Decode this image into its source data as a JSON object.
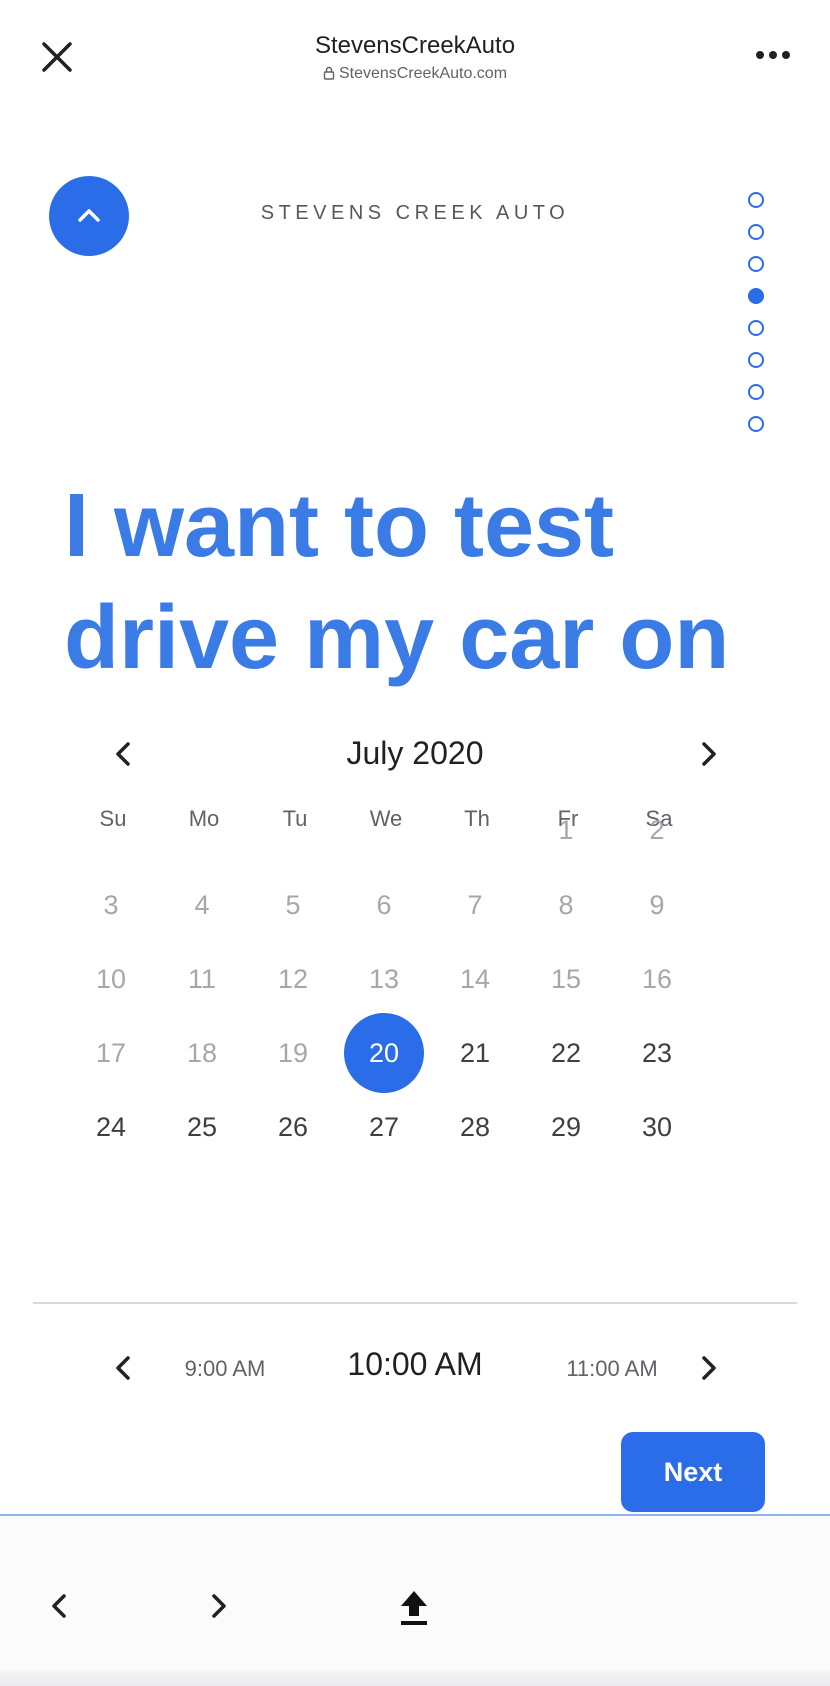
{
  "browser": {
    "title": "StevensCreekAuto",
    "url": "StevensCreekAuto.com"
  },
  "page": {
    "brand": "STEVENS CREEK AUTO",
    "headline_line1": "I want to test",
    "headline_line2": "drive my car on",
    "progress": {
      "total_steps": 8,
      "current_step": 4
    }
  },
  "calendar": {
    "month_label": "July 2020",
    "weekdays": [
      "Su",
      "Mo",
      "Tu",
      "We",
      "Th",
      "Fr",
      "Sa"
    ],
    "weeks": [
      [
        "",
        "",
        "",
        "",
        "",
        "1",
        "2"
      ],
      [
        "3",
        "4",
        "5",
        "6",
        "7",
        "8",
        "9"
      ],
      [
        "10",
        "11",
        "12",
        "13",
        "14",
        "15",
        "16"
      ],
      [
        "17",
        "18",
        "19",
        "20",
        "21",
        "22",
        "23"
      ],
      [
        "24",
        "25",
        "26",
        "27",
        "28",
        "29",
        "30"
      ]
    ],
    "selected_day": "20",
    "first_available_day": 20
  },
  "time": {
    "previous": "9:00 AM",
    "current": "10:00 AM",
    "next": "11:00 AM"
  },
  "actions": {
    "next_label": "Next"
  },
  "colors": {
    "accent": "#2b6de8",
    "headline": "#3a7be6",
    "disabled_day": "#a4a7ab"
  },
  "icons": {
    "close": "close-icon",
    "more": "more-horizontal-icon",
    "lock": "lock-icon",
    "up": "chevron-up-icon",
    "prev": "chevron-left-icon",
    "next": "chevron-right-icon",
    "share": "share-upload-icon"
  }
}
